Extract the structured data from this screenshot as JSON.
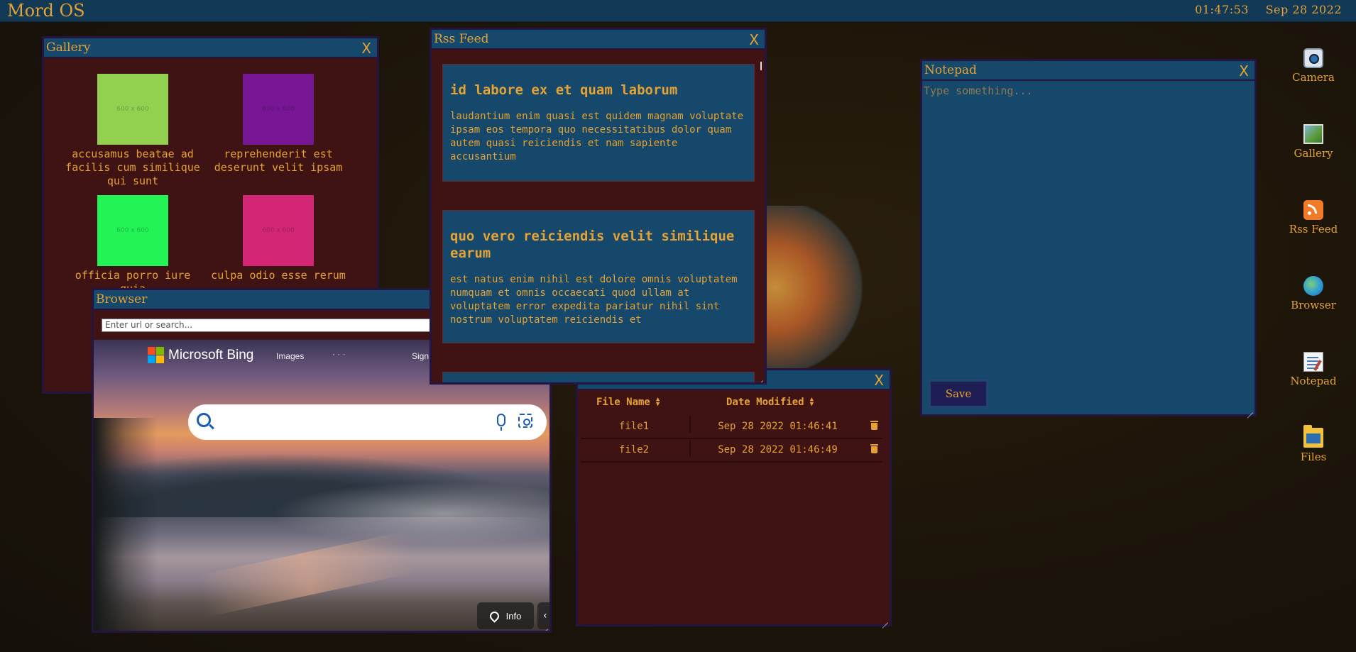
{
  "topbar": {
    "os_title": "Mord OS",
    "time": "01:47:53",
    "date": "Sep 28 2022"
  },
  "gallery": {
    "title": "Gallery",
    "close": "X",
    "items": [
      {
        "caption": "accusamus beatae ad facilis cum similique qui sunt",
        "color": "#92d050",
        "placeholder": "600 x 600"
      },
      {
        "caption": "reprehenderit est deserunt velit ipsam",
        "color": "#771796",
        "placeholder": "600 x 600"
      },
      {
        "caption": "officia porro iure quia",
        "color": "#24f355",
        "placeholder": "600 x 600"
      },
      {
        "caption": "culpa odio esse rerum",
        "color": "#d32776",
        "placeholder": "600 x 600"
      }
    ]
  },
  "rss": {
    "title": "Rss Feed",
    "close": "X",
    "items": [
      {
        "title": "id labore ex et quam laborum",
        "body": "laudantium enim quasi est quidem magnam voluptate ipsam eos tempora quo necessitatibus dolor quam autem quasi reiciendis et nam sapiente accusantium"
      },
      {
        "title": "quo vero reiciendis velit similique earum",
        "body": "est natus enim nihil est dolore omnis voluptatem numquam et omnis occaecati quod ullam at voluptatem error expedita pariatur nihil sint nostrum voluptatem reiciendis et"
      }
    ]
  },
  "notepad": {
    "title": "Notepad",
    "close": "X",
    "placeholder": "Type something...",
    "save_label": "Save"
  },
  "files": {
    "close": "X",
    "columns": [
      "File Name",
      "Date Modified"
    ],
    "rows": [
      {
        "name": "file1",
        "modified": "Sep 28 2022 01:46:41"
      },
      {
        "name": "file2",
        "modified": "Sep 28 2022 01:46:49"
      }
    ]
  },
  "browser": {
    "title": "Browser",
    "url_placeholder": "Enter url or search...",
    "bing_logo": "Microsoft Bing",
    "nav_images": "Images",
    "nav_more": "· · ·",
    "nav_sign": "Sign",
    "info_label": "Info",
    "chevron": "‹"
  },
  "desktop_icons": [
    {
      "label": "Camera",
      "icon": "camera-icon"
    },
    {
      "label": "Gallery",
      "icon": "gallery-icon"
    },
    {
      "label": "Rss Feed",
      "icon": "rss-icon"
    },
    {
      "label": "Browser",
      "icon": "browser-icon"
    },
    {
      "label": "Notepad",
      "icon": "notepad-icon"
    },
    {
      "label": "Files",
      "icon": "files-icon"
    }
  ],
  "colors": {
    "accent": "#e5a233",
    "titlebar": "#15486b",
    "window_bg": "#3f1313",
    "border": "#231442"
  }
}
